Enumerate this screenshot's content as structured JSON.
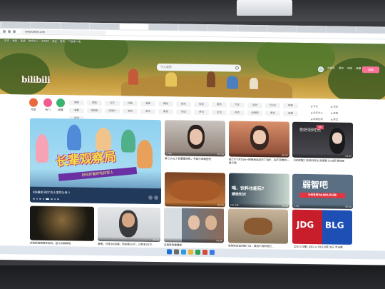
{
  "browser": {
    "tabs": [
      "",
      "",
      "",
      "",
      "",
      "",
      "",
      "",
      "",
      "",
      "",
      "",
      ""
    ],
    "url": "www.bilibili.com"
  },
  "header": {
    "nav": [
      "首页",
      "番剧",
      "直播",
      "游戏中心",
      "会员购",
      "漫画",
      "赛事",
      "下载客户端"
    ],
    "logo": "bilibili",
    "search_placeholder": "千人逐梦",
    "right_nav": [
      "大会员",
      "消息",
      "动态",
      "收藏",
      "历史",
      "创作中心"
    ],
    "upload_label": "投稿"
  },
  "quick_links": [
    {
      "label": "动态",
      "color": "#e9683c"
    },
    {
      "label": "热门",
      "color": "#f25d8e"
    },
    {
      "label": "频道",
      "color": "#3cb371"
    }
  ],
  "channels": [
    "番剧",
    "国创",
    "综艺",
    "动画",
    "鬼畜",
    "舞蹈",
    "娱乐",
    "科技",
    "美食",
    "汽车",
    "运动",
    "VLOG",
    "搞笑",
    "电影",
    "电视剧",
    "纪录片",
    "游戏",
    "音乐",
    "影视",
    "知识",
    "资讯",
    "生活",
    "时尚",
    "动物圈",
    "更多",
    "直播",
    "课堂"
  ],
  "side_links": [
    "专栏",
    "活动",
    "社区中心",
    "直播",
    "新歌热榜",
    "课堂"
  ],
  "hero": {
    "title_art": "长辈观察局",
    "subtitle_art": "好玩好看好吃好家人",
    "caption": "B站重金寻找\"别人家的父母\"!"
  },
  "cards": [
    {
      "title": "第二vlog丨前要是刚刚，不能只说哪些吧",
      "meta": "",
      "views": "1.4万",
      "duration": "07:55"
    },
    {
      "title": "船了9个月10w+把我表弟送去了进步，说不尽数的一章子啊",
      "meta": "",
      "views": "",
      "duration": "06:37"
    },
    {
      "title": "【4K修复】你好旧时光 赵丽颖 Live版 我到底",
      "meta": "",
      "views": "",
      "duration": "04:46"
    },
    {
      "title": "随手一拍!物特什比养都是家里最绝话的水 !去年拍回一套！",
      "meta": "",
      "views": "",
      "duration": "04:21"
    },
    {
      "title": "喝，饮料也能玩？",
      "meta": "",
      "views": "187.3万",
      "duration": "10:24",
      "overlay": "喝，饮料也能玩？ 硬核知识"
    },
    {
      "title": "弱智吧：为何有人为AI的头号公敌",
      "meta": "",
      "views": "1.1万",
      "duration": "05:18",
      "overlay": "弱智吧",
      "overlay2": "为何将成为AI的头号公敌"
    },
    {
      "title": "迟迷保组随便东部玩，超小的精神及",
      "meta": "",
      "views": "",
      "duration": ""
    },
    {
      "title": "骏熊，日常1000袋，你的家10万，公积金20万…",
      "meta": "",
      "views": "",
      "duration": "04:23"
    },
    {
      "title": "这我家真看看挨",
      "meta": "",
      "views": "",
      "duration": ""
    },
    {
      "title": "",
      "meta": "",
      "views": "",
      "duration": "01:38"
    },
    {
      "title": "当狗狗没追到家门口，我找不到的地方…",
      "meta": "",
      "views": "",
      "duration": ""
    },
    {
      "title": "【2023 S赛】JDG vs BLG 8月10日 半决赛",
      "meta": "",
      "views": "",
      "duration": ""
    }
  ],
  "taskbar": {
    "time": ""
  }
}
